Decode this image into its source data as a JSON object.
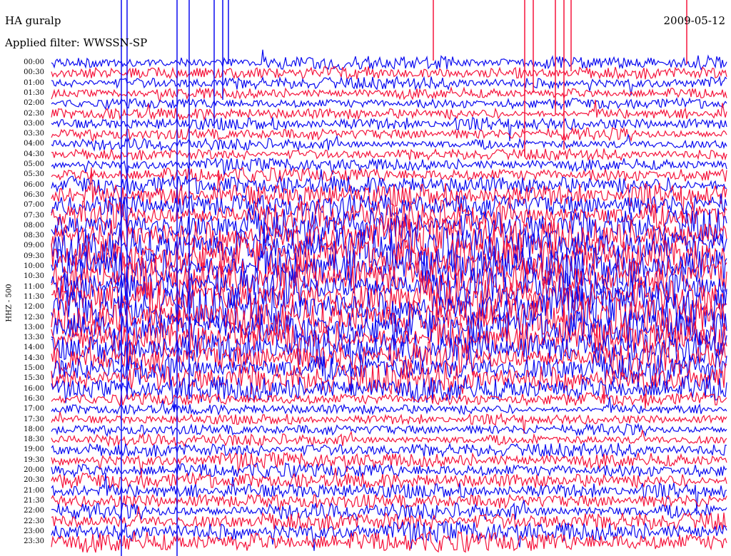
{
  "header": {
    "station": "HA guralp",
    "date": "2009-05-12",
    "filter": "Applied filter: WWSSN-SP",
    "channel": "HHZ - 500"
  },
  "colors": {
    "trace_a": "#0b0bf0",
    "trace_b": "#f5143c",
    "background": "#ffffff",
    "text": "#000000"
  },
  "chart_data": {
    "type": "helicorder",
    "title": "HA guralp",
    "subtitle": "Applied filter: WWSSN-SP",
    "date": "2009-05-12",
    "ylabel": "HHZ - 500",
    "row_interval_minutes": 30,
    "row_labels": [
      "00:00",
      "00:30",
      "01:00",
      "01:30",
      "02:00",
      "02:30",
      "03:00",
      "03:30",
      "04:00",
      "04:30",
      "05:00",
      "05:30",
      "06:00",
      "06:30",
      "07:00",
      "07:30",
      "08:00",
      "08:30",
      "09:00",
      "09:30",
      "10:00",
      "10:30",
      "11:00",
      "11:30",
      "12:00",
      "12:30",
      "13:00",
      "13:30",
      "14:00",
      "14:30",
      "15:00",
      "15:30",
      "16:00",
      "16:30",
      "17:00",
      "17:30",
      "18:00",
      "18:30",
      "19:00",
      "19:30",
      "20:00",
      "20:30",
      "21:00",
      "21:30",
      "22:00",
      "22:30",
      "23:00",
      "23:30"
    ],
    "row_colors_alternate": [
      "#0b0bf0",
      "#f5143c"
    ],
    "relative_amplitude": [
      1.2,
      1.0,
      1.0,
      0.9,
      0.9,
      1.0,
      1.1,
      1.1,
      1.0,
      0.9,
      1.0,
      1.2,
      1.6,
      2.0,
      2.3,
      2.6,
      2.8,
      3.0,
      3.2,
      3.3,
      3.5,
      3.5,
      3.4,
      3.4,
      3.3,
      3.3,
      3.2,
      3.1,
      3.0,
      2.9,
      2.7,
      2.5,
      2.2,
      1.1,
      0.9,
      0.9,
      1.0,
      1.0,
      1.1,
      1.2,
      1.2,
      1.3,
      1.3,
      1.4,
      1.4,
      1.5,
      1.6,
      1.7
    ]
  }
}
